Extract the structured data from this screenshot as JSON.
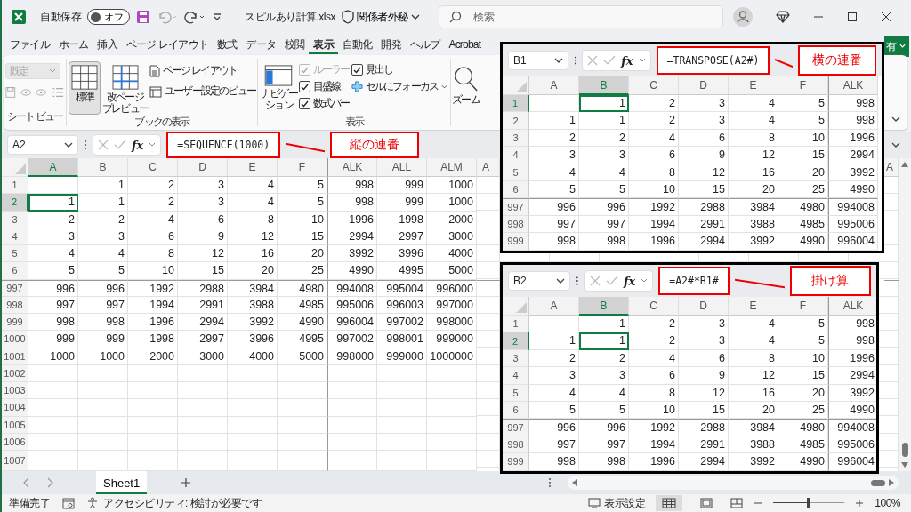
{
  "title_bar": {
    "autosave_label": "自動保存",
    "autosave": {
      "on": false,
      "label": "オフ"
    },
    "filename": "スピルあり計算.xlsx",
    "sensitivity": "関係者外秘",
    "search": {
      "placeholder": "検索"
    }
  },
  "tabs": [
    {
      "label": "ファイル",
      "selected": false
    },
    {
      "label": "ホーム",
      "selected": false
    },
    {
      "label": "挿入",
      "selected": false
    },
    {
      "label": "ページ レイアウト",
      "selected": false
    },
    {
      "label": "数式",
      "selected": false
    },
    {
      "label": "データ",
      "selected": false
    },
    {
      "label": "校閲",
      "selected": false
    },
    {
      "label": "表示",
      "selected": true
    },
    {
      "label": "自動化",
      "selected": false
    },
    {
      "label": "開発",
      "selected": false
    },
    {
      "label": "ヘルプ",
      "selected": false
    },
    {
      "label": "Acrobat",
      "selected": false
    }
  ],
  "share_button": "有",
  "ribbon": {
    "sheet_view": {
      "label": "シート ビュー",
      "dropdown": {
        "value": "既定",
        "disabled": true
      }
    },
    "workbook_views": {
      "label": "ブックの表示",
      "buttons": [
        {
          "lines": [
            "標準"
          ],
          "selected": true
        },
        {
          "lines": [
            "改ページ",
            "プレビュー"
          ],
          "selected": false
        }
      ],
      "small": [
        "ページ レイアウト",
        "ユーザー設定のビュー"
      ]
    },
    "show": {
      "label": "表示",
      "navigation": [
        "ナビゲー",
        "ション"
      ],
      "checks": [
        {
          "label": "ルーラー",
          "checked": true,
          "disabled": true
        },
        {
          "label": "目盛線",
          "checked": true,
          "disabled": false
        },
        {
          "label": "数式バー",
          "checked": true,
          "disabled": false
        },
        {
          "label": "見出し",
          "checked": true,
          "disabled": false
        }
      ],
      "focus_cell": "セルにフォーカス"
    },
    "zoom": "ズーム"
  },
  "sheet": {
    "name_box": "A2",
    "fx": "fx",
    "formula": "=SEQUENCE(1000)",
    "callout": "縦の連番",
    "edge_column": "A",
    "columns": [
      {
        "label": "A",
        "selected": true
      },
      {
        "label": "B",
        "selected": false
      },
      {
        "label": "C",
        "selected": false
      },
      {
        "label": "D",
        "selected": false
      },
      {
        "label": "E",
        "selected": false
      },
      {
        "label": "F",
        "selected": false
      },
      {
        "label": "ALK",
        "selected": false
      },
      {
        "label": "ALL",
        "selected": false
      },
      {
        "label": "ALM",
        "selected": false
      },
      {
        "label": "A",
        "selected": false
      }
    ],
    "rows": [
      {
        "label": "1",
        "selected": false,
        "cells": [
          null,
          "1",
          "2",
          "3",
          "4",
          "5",
          "998",
          "999",
          "1000"
        ]
      },
      {
        "label": "2",
        "selected": true,
        "cells": [
          "1",
          "1",
          "2",
          "3",
          "4",
          "5",
          "998",
          "999",
          "1000"
        ]
      },
      {
        "label": "3",
        "selected": false,
        "cells": [
          "2",
          "2",
          "4",
          "6",
          "8",
          "10",
          "1996",
          "1998",
          "2000"
        ]
      },
      {
        "label": "4",
        "selected": false,
        "cells": [
          "3",
          "3",
          "6",
          "9",
          "12",
          "15",
          "2994",
          "2997",
          "3000"
        ]
      },
      {
        "label": "5",
        "selected": false,
        "cells": [
          "4",
          "4",
          "8",
          "12",
          "16",
          "20",
          "3992",
          "3996",
          "4000"
        ]
      },
      {
        "label": "6",
        "selected": false,
        "cells": [
          "5",
          "5",
          "10",
          "15",
          "20",
          "25",
          "4990",
          "4995",
          "5000"
        ]
      },
      {
        "label": "997",
        "selected": false,
        "cells": [
          "996",
          "996",
          "1992",
          "2988",
          "3984",
          "4980",
          "994008",
          "995004",
          "996000"
        ]
      },
      {
        "label": "998",
        "selected": false,
        "cells": [
          "997",
          "997",
          "1994",
          "2991",
          "3988",
          "4985",
          "995006",
          "996003",
          "997000"
        ]
      },
      {
        "label": "999",
        "selected": false,
        "cells": [
          "998",
          "998",
          "1996",
          "2994",
          "3992",
          "4990",
          "996004",
          "997002",
          "998000"
        ]
      },
      {
        "label": "1000",
        "selected": false,
        "cells": [
          "999",
          "999",
          "1998",
          "2997",
          "3996",
          "4995",
          "997002",
          "998001",
          "999000"
        ]
      },
      {
        "label": "1001",
        "selected": false,
        "cells": [
          "1000",
          "1000",
          "2000",
          "3000",
          "4000",
          "5000",
          "998000",
          "999000",
          "1000000"
        ]
      },
      {
        "label": "1002",
        "selected": false,
        "cells": []
      },
      {
        "label": "1003",
        "selected": false,
        "cells": []
      },
      {
        "label": "1004",
        "selected": false,
        "cells": []
      },
      {
        "label": "1005",
        "selected": false,
        "cells": []
      },
      {
        "label": "1006",
        "selected": false,
        "cells": []
      },
      {
        "label": "1007",
        "selected": false,
        "cells": []
      }
    ]
  },
  "insets": [
    {
      "name_box": "B1",
      "fx": "fx",
      "formula": "=TRANSPOSE(A2#)",
      "callout": "横の連番",
      "columns": [
        {
          "label": "A",
          "selected": false
        },
        {
          "label": "B",
          "selected": true
        },
        {
          "label": "C",
          "selected": false
        },
        {
          "label": "D",
          "selected": false
        },
        {
          "label": "E",
          "selected": false
        },
        {
          "label": "F",
          "selected": false
        },
        {
          "label": "ALK",
          "selected": false
        }
      ],
      "rows": [
        {
          "label": "1",
          "selected": true,
          "cells": [
            null,
            "1",
            "2",
            "3",
            "4",
            "5",
            "998"
          ]
        },
        {
          "label": "2",
          "selected": false,
          "cells": [
            "1",
            "1",
            "2",
            "3",
            "4",
            "5",
            "998"
          ]
        },
        {
          "label": "3",
          "selected": false,
          "cells": [
            "2",
            "2",
            "4",
            "6",
            "8",
            "10",
            "1996"
          ]
        },
        {
          "label": "4",
          "selected": false,
          "cells": [
            "3",
            "3",
            "6",
            "9",
            "12",
            "15",
            "2994"
          ]
        },
        {
          "label": "5",
          "selected": false,
          "cells": [
            "4",
            "4",
            "8",
            "12",
            "16",
            "20",
            "3992"
          ]
        },
        {
          "label": "6",
          "selected": false,
          "cells": [
            "5",
            "5",
            "10",
            "15",
            "20",
            "25",
            "4990"
          ]
        },
        {
          "label": "997",
          "selected": false,
          "cells": [
            "996",
            "996",
            "1992",
            "2988",
            "3984",
            "4980",
            "994008"
          ]
        },
        {
          "label": "998",
          "selected": false,
          "cells": [
            "997",
            "997",
            "1994",
            "2991",
            "3988",
            "4985",
            "995006"
          ]
        },
        {
          "label": "999",
          "selected": false,
          "cells": [
            "998",
            "998",
            "1996",
            "2994",
            "3992",
            "4990",
            "996004"
          ]
        }
      ]
    },
    {
      "name_box": "B2",
      "fx": "fx",
      "formula": "=A2#*B1#",
      "callout": "掛け算",
      "columns": [
        {
          "label": "A",
          "selected": false
        },
        {
          "label": "B",
          "selected": true
        },
        {
          "label": "C",
          "selected": false
        },
        {
          "label": "D",
          "selected": false
        },
        {
          "label": "E",
          "selected": false
        },
        {
          "label": "F",
          "selected": false
        },
        {
          "label": "ALK",
          "selected": false
        }
      ],
      "rows": [
        {
          "label": "1",
          "selected": false,
          "cells": [
            null,
            "1",
            "2",
            "3",
            "4",
            "5",
            "998"
          ]
        },
        {
          "label": "2",
          "selected": true,
          "cells": [
            "1",
            "1",
            "2",
            "3",
            "4",
            "5",
            "998"
          ]
        },
        {
          "label": "3",
          "selected": false,
          "cells": [
            "2",
            "2",
            "4",
            "6",
            "8",
            "10",
            "1996"
          ]
        },
        {
          "label": "4",
          "selected": false,
          "cells": [
            "3",
            "3",
            "6",
            "9",
            "12",
            "15",
            "2994"
          ]
        },
        {
          "label": "5",
          "selected": false,
          "cells": [
            "4",
            "4",
            "8",
            "12",
            "16",
            "20",
            "3992"
          ]
        },
        {
          "label": "6",
          "selected": false,
          "cells": [
            "5",
            "5",
            "10",
            "15",
            "20",
            "25",
            "4990"
          ]
        },
        {
          "label": "997",
          "selected": false,
          "cells": [
            "996",
            "996",
            "1992",
            "2988",
            "3984",
            "4980",
            "994008"
          ]
        },
        {
          "label": "998",
          "selected": false,
          "cells": [
            "997",
            "997",
            "1994",
            "2991",
            "3988",
            "4985",
            "995006"
          ]
        },
        {
          "label": "999",
          "selected": false,
          "cells": [
            "998",
            "998",
            "1996",
            "2994",
            "3992",
            "4990",
            "996004"
          ]
        }
      ]
    }
  ],
  "sheet_tabs": [
    {
      "label": "Sheet1",
      "selected": true
    }
  ],
  "status_bar": {
    "ready": "準備完了",
    "accessibility": "アクセシビリティ: 検討が必要です",
    "display_settings": "表示設定",
    "zoom": {
      "level": 0.5,
      "reading": "100%"
    }
  }
}
